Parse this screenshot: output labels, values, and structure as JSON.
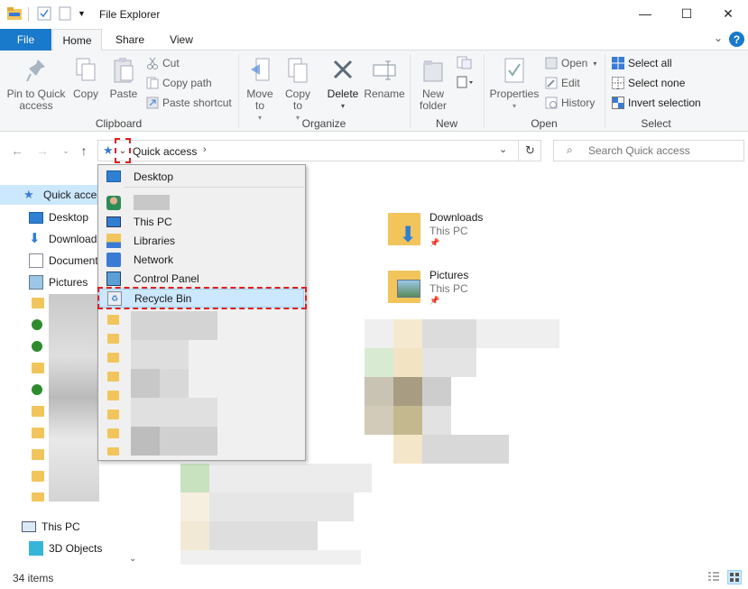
{
  "window": {
    "title": "File Explorer"
  },
  "tabs": {
    "file": "File",
    "home": "Home",
    "share": "Share",
    "view": "View"
  },
  "ribbon": {
    "clipboard": {
      "pin_label": "Pin to Quick access",
      "copy_label": "Copy",
      "paste_label": "Paste",
      "cut_label": "Cut",
      "copy_path_label": "Copy path",
      "paste_shortcut_label": "Paste shortcut",
      "group_label": "Clipboard"
    },
    "organize": {
      "move_to_label": "Move to",
      "copy_to_label": "Copy to",
      "delete_label": "Delete",
      "rename_label": "Rename",
      "group_label": "Organize"
    },
    "new": {
      "new_folder_label": "New folder",
      "group_label": "New"
    },
    "open": {
      "properties_label": "Properties",
      "open_label": "Open",
      "edit_label": "Edit",
      "history_label": "History",
      "group_label": "Open"
    },
    "select": {
      "select_all_label": "Select all",
      "select_none_label": "Select none",
      "invert_label": "Invert selection",
      "group_label": "Select"
    }
  },
  "address": {
    "path": "Quick access",
    "search_placeholder": "Search Quick access"
  },
  "nav_pane": {
    "quick_access": "Quick access",
    "items": [
      "Desktop",
      "Downloads",
      "Documents",
      "Pictures"
    ],
    "this_pc": "This PC",
    "objects_3d": "3D Objects"
  },
  "dropdown": {
    "items": [
      "Desktop",
      "",
      "This PC",
      "Libraries",
      "Network",
      "Control Panel",
      "Recycle Bin"
    ]
  },
  "content": {
    "downloads": {
      "name": "Downloads",
      "location": "This PC"
    },
    "pictures": {
      "name": "Pictures",
      "location": "This PC"
    }
  },
  "status": {
    "count": "34 items"
  },
  "colors": {
    "accent": "#1979ca",
    "highlight": "#cce8ff",
    "annotation": "#e02020"
  }
}
